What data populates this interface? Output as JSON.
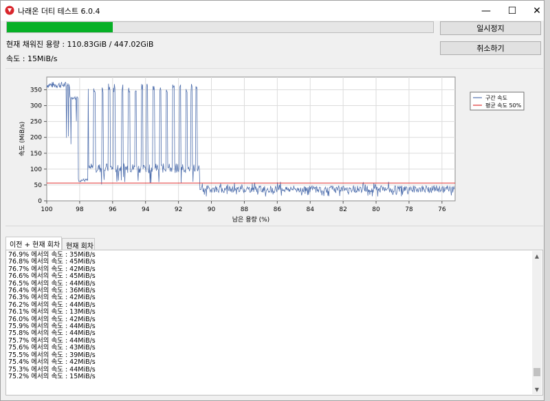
{
  "window": {
    "title": "나래온 더티 테스트 6.0.4",
    "controls": {
      "minimize": "—",
      "maximize": "☐",
      "close": "✕"
    }
  },
  "progress": {
    "fraction": 0.248
  },
  "buttons": {
    "pause": "일시정지",
    "cancel": "취소하기"
  },
  "status": {
    "filled_capacity": "현재 채워진 용량 : 110.83GiB / 447.02GiB",
    "speed": "속도 : 15MiB/s"
  },
  "chart_data": {
    "type": "line",
    "xlabel": "남은 용량 (%)",
    "ylabel": "속도 (MiB/s)",
    "xlim": [
      100,
      75.2
    ],
    "ylim": [
      0,
      390
    ],
    "x_ticks": [
      "100",
      "98",
      "96",
      "94",
      "92",
      "90",
      "88",
      "86",
      "84",
      "82",
      "80",
      "78",
      "76"
    ],
    "y_ticks": [
      "0",
      "50",
      "100",
      "150",
      "200",
      "250",
      "300",
      "350"
    ],
    "grid": true,
    "legend_position": "right",
    "series": [
      {
        "name": "구간 속도",
        "color": "#4f6fad"
      },
      {
        "name": "평균 속도 50%",
        "color": "#e03030",
        "value": 56
      }
    ]
  },
  "tabs": [
    {
      "label": "이전 + 현재 회차",
      "active": true
    },
    {
      "label": "현재 회차",
      "active": false
    }
  ],
  "log": [
    "76.9% 에서의 속도 : 35MiB/s",
    "76.8% 에서의 속도 : 45MiB/s",
    "76.7% 에서의 속도 : 42MiB/s",
    "76.6% 에서의 속도 : 45MiB/s",
    "76.5% 에서의 속도 : 44MiB/s",
    "76.4% 에서의 속도 : 36MiB/s",
    "76.3% 에서의 속도 : 42MiB/s",
    "76.2% 에서의 속도 : 44MiB/s",
    "76.1% 에서의 속도 : 13MiB/s",
    "76.0% 에서의 속도 : 42MiB/s",
    "75.9% 에서의 속도 : 44MiB/s",
    "75.8% 에서의 속도 : 44MiB/s",
    "75.7% 에서의 속도 : 44MiB/s",
    "75.6% 에서의 속도 : 43MiB/s",
    "75.5% 에서의 속도 : 39MiB/s",
    "75.4% 에서의 속도 : 42MiB/s",
    "75.3% 에서의 속도 : 44MiB/s",
    "75.2% 에서의 속도 : 15MiB/s"
  ],
  "scroll": {
    "thumb_position": 0.93,
    "thumb_size": 0.07
  }
}
